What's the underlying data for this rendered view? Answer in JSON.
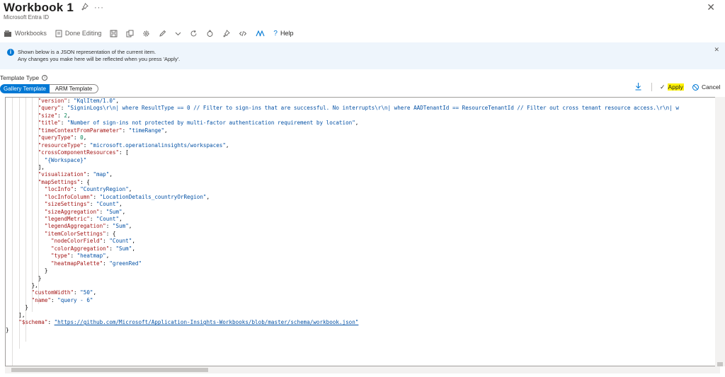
{
  "header": {
    "title": "Workbook 1",
    "subtitle": "Microsoft Entra ID",
    "more_label": "···",
    "close_label": "✕"
  },
  "toolbar": {
    "workbooks_label": "Workbooks",
    "done_editing_label": "Done Editing",
    "help_label": "Help"
  },
  "info": {
    "line1": "Shown below is a JSON representation of the current item.",
    "line2": "Any changes you make here will be reflected when you press 'Apply'."
  },
  "template_type": {
    "label": "Template Type",
    "options": [
      "Gallery Template",
      "ARM Template"
    ],
    "selected": "Gallery Template"
  },
  "actions": {
    "apply_label": "Apply",
    "cancel_label": "Cancel"
  },
  "editor": {
    "lines": [
      [
        [
          "p",
          "          "
        ],
        [
          "k",
          "\"version\""
        ],
        [
          "p",
          ": "
        ],
        [
          "s",
          "\"KqlItem/1.0\""
        ],
        [
          "p",
          ","
        ]
      ],
      [
        [
          "p",
          "          "
        ],
        [
          "k",
          "\"query\""
        ],
        [
          "p",
          ": "
        ],
        [
          "s",
          "\"SigninLogs\\r\\n| where ResultType == 0 // Filter to sign-ins that are successful. No interrupts\\r\\n| where AADTenantId == ResourceTenantId // Filter out cross tenant resource access.\\r\\n| w"
        ]
      ],
      [
        [
          "p",
          "          "
        ],
        [
          "k",
          "\"size\""
        ],
        [
          "p",
          ": "
        ],
        [
          "n",
          "2"
        ],
        [
          "p",
          ","
        ]
      ],
      [
        [
          "p",
          "          "
        ],
        [
          "k",
          "\"title\""
        ],
        [
          "p",
          ": "
        ],
        [
          "s",
          "\"Number of sign-ins not protected by multi-factor authentication requirement by location\""
        ],
        [
          "p",
          ","
        ]
      ],
      [
        [
          "p",
          "          "
        ],
        [
          "k",
          "\"timeContextFromParameter\""
        ],
        [
          "p",
          ": "
        ],
        [
          "s",
          "\"timeRange\""
        ],
        [
          "p",
          ","
        ]
      ],
      [
        [
          "p",
          "          "
        ],
        [
          "k",
          "\"queryType\""
        ],
        [
          "p",
          ": "
        ],
        [
          "n",
          "0"
        ],
        [
          "p",
          ","
        ]
      ],
      [
        [
          "p",
          "          "
        ],
        [
          "k",
          "\"resourceType\""
        ],
        [
          "p",
          ": "
        ],
        [
          "s",
          "\"microsoft.operationalinsights/workspaces\""
        ],
        [
          "p",
          ","
        ]
      ],
      [
        [
          "p",
          "          "
        ],
        [
          "k",
          "\"crossComponentResources\""
        ],
        [
          "p",
          ": ["
        ]
      ],
      [
        [
          "p",
          "            "
        ],
        [
          "s",
          "\"{Workspace}\""
        ]
      ],
      [
        [
          "p",
          "          ],"
        ]
      ],
      [
        [
          "p",
          "          "
        ],
        [
          "k",
          "\"visualization\""
        ],
        [
          "p",
          ": "
        ],
        [
          "s",
          "\"map\""
        ],
        [
          "p",
          ","
        ]
      ],
      [
        [
          "p",
          "          "
        ],
        [
          "k",
          "\"mapSettings\""
        ],
        [
          "p",
          ": {"
        ]
      ],
      [
        [
          "p",
          "            "
        ],
        [
          "k",
          "\"locInfo\""
        ],
        [
          "p",
          ": "
        ],
        [
          "s",
          "\"CountryRegion\""
        ],
        [
          "p",
          ","
        ]
      ],
      [
        [
          "p",
          "            "
        ],
        [
          "k",
          "\"locInfoColumn\""
        ],
        [
          "p",
          ": "
        ],
        [
          "s",
          "\"LocationDetails_countryOrRegion\""
        ],
        [
          "p",
          ","
        ]
      ],
      [
        [
          "p",
          "            "
        ],
        [
          "k",
          "\"sizeSettings\""
        ],
        [
          "p",
          ": "
        ],
        [
          "s",
          "\"Count\""
        ],
        [
          "p",
          ","
        ]
      ],
      [
        [
          "p",
          "            "
        ],
        [
          "k",
          "\"sizeAggregation\""
        ],
        [
          "p",
          ": "
        ],
        [
          "s",
          "\"Sum\""
        ],
        [
          "p",
          ","
        ]
      ],
      [
        [
          "p",
          "            "
        ],
        [
          "k",
          "\"legendMetric\""
        ],
        [
          "p",
          ": "
        ],
        [
          "s",
          "\"Count\""
        ],
        [
          "p",
          ","
        ]
      ],
      [
        [
          "p",
          "            "
        ],
        [
          "k",
          "\"legendAggregation\""
        ],
        [
          "p",
          ": "
        ],
        [
          "s",
          "\"Sum\""
        ],
        [
          "p",
          ","
        ]
      ],
      [
        [
          "p",
          "            "
        ],
        [
          "k",
          "\"itemColorSettings\""
        ],
        [
          "p",
          ": {"
        ]
      ],
      [
        [
          "p",
          "              "
        ],
        [
          "k",
          "\"nodeColorField\""
        ],
        [
          "p",
          ": "
        ],
        [
          "s",
          "\"Count\""
        ],
        [
          "p",
          ","
        ]
      ],
      [
        [
          "p",
          "              "
        ],
        [
          "k",
          "\"colorAggregation\""
        ],
        [
          "p",
          ": "
        ],
        [
          "s",
          "\"Sum\""
        ],
        [
          "p",
          ","
        ]
      ],
      [
        [
          "p",
          "              "
        ],
        [
          "k",
          "\"type\""
        ],
        [
          "p",
          ": "
        ],
        [
          "s",
          "\"heatmap\""
        ],
        [
          "p",
          ","
        ]
      ],
      [
        [
          "p",
          "              "
        ],
        [
          "k",
          "\"heatmapPalette\""
        ],
        [
          "p",
          ": "
        ],
        [
          "s",
          "\"greenRed\""
        ]
      ],
      [
        [
          "p",
          "            }"
        ]
      ],
      [
        [
          "p",
          "          }"
        ]
      ],
      [
        [
          "p",
          "        },"
        ]
      ],
      [
        [
          "p",
          "        "
        ],
        [
          "k",
          "\"customWidth\""
        ],
        [
          "p",
          ": "
        ],
        [
          "s",
          "\"50\""
        ],
        [
          "p",
          ","
        ]
      ],
      [
        [
          "p",
          "        "
        ],
        [
          "k",
          "\"name\""
        ],
        [
          "p",
          ": "
        ],
        [
          "s",
          "\"query - 6\""
        ]
      ],
      [
        [
          "p",
          "      }"
        ]
      ],
      [
        [
          "p",
          "    ],"
        ]
      ],
      [
        [
          "p",
          "    "
        ],
        [
          "k",
          "\"$schema\""
        ],
        [
          "p",
          ": "
        ],
        [
          "u",
          "\"https://github.com/Microsoft/Application-Insights-Workbooks/blob/master/schema/workbook.json\""
        ]
      ],
      [
        [
          "p",
          "}"
        ]
      ]
    ]
  }
}
